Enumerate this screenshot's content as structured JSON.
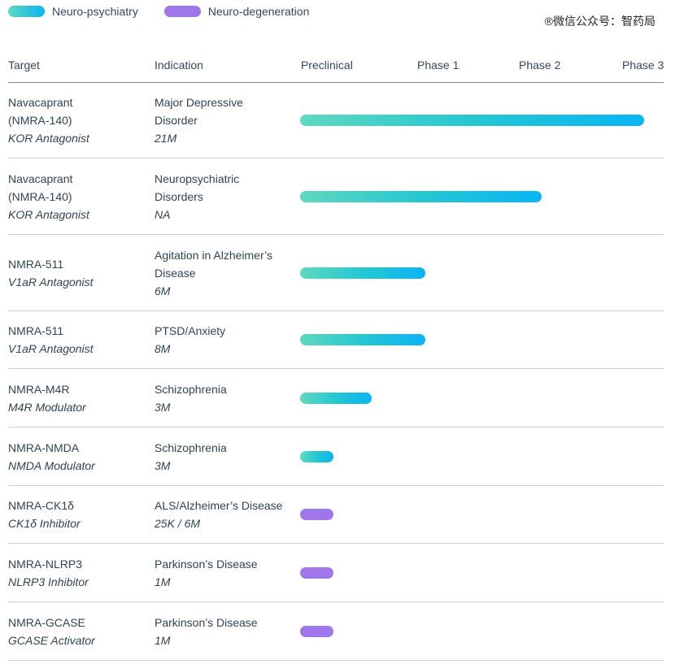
{
  "legend": [
    {
      "label": "Neuro-psychiatry",
      "key": "np",
      "color": "#2fc6d8"
    },
    {
      "label": "Neuro-degeneration",
      "key": "nd",
      "color": "#a077ea"
    }
  ],
  "watermark": "®微信公众号：智药局",
  "headers": {
    "target": "Target",
    "indication": "Indication",
    "phases": [
      "Preclinical",
      "Phase 1",
      "Phase 2",
      "Phase 3"
    ]
  },
  "chart_data": {
    "type": "bar",
    "orientation": "horizontal",
    "x_stages": [
      "Preclinical",
      "Phase 1",
      "Phase 2",
      "Phase 3"
    ],
    "xlim": [
      0,
      3
    ],
    "rows": [
      {
        "target_lines": [
          "Navacaprant",
          "(NMRA-140)"
        ],
        "mechanism": "KOR Antagonist",
        "indication_lines": [
          "Major Depressive",
          "Disorder"
        ],
        "population": "21M",
        "category": "np",
        "progress": 2.8
      },
      {
        "target_lines": [
          "Navacaprant",
          "(NMRA-140)"
        ],
        "mechanism": "KOR Antagonist",
        "indication_lines": [
          "Neuropsychiatric",
          "Disorders"
        ],
        "population": "NA",
        "category": "np",
        "progress": 1.97
      },
      {
        "target_lines": [
          "NMRA-511"
        ],
        "mechanism": "V1aR Antagonist",
        "indication_lines": [
          "Agitation in Alzheimer’s",
          "Disease"
        ],
        "population": "6M",
        "category": "np",
        "progress": 1.02
      },
      {
        "target_lines": [
          "NMRA-511"
        ],
        "mechanism": "V1aR Antagonist",
        "indication_lines": [
          "PTSD/Anxiety"
        ],
        "population": "8M",
        "category": "np",
        "progress": 1.02
      },
      {
        "target_lines": [
          "NMRA-M4R"
        ],
        "mechanism": "M4R Modulator",
        "indication_lines": [
          "Schizophrenia"
        ],
        "population": "3M",
        "category": "np",
        "progress": 0.58
      },
      {
        "target_lines": [
          "NMRA-NMDA"
        ],
        "mechanism": "NMDA Modulator",
        "indication_lines": [
          "Schizophrenia"
        ],
        "population": "3M",
        "category": "np",
        "progress": 0.27
      },
      {
        "target_lines": [
          "NMRA-CK1δ"
        ],
        "mechanism": "CK1δ  Inhibitor",
        "indication_lines": [
          "ALS/Alzheimer’s Disease"
        ],
        "population": "25K / 6M",
        "category": "nd",
        "progress": 0.27
      },
      {
        "target_lines": [
          "NMRA-NLRP3"
        ],
        "mechanism": "NLRP3 Inhibitor",
        "indication_lines": [
          "Parkinson’s Disease"
        ],
        "population": "1M",
        "category": "nd",
        "progress": 0.27
      },
      {
        "target_lines": [
          "NMRA-GCASE"
        ],
        "mechanism": "GCASE Activator",
        "indication_lines": [
          "Parkinson’s Disease"
        ],
        "population": "1M",
        "category": "nd",
        "progress": 0.27
      }
    ]
  }
}
